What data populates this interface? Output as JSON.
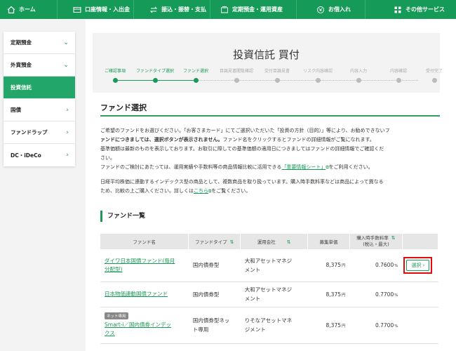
{
  "topnav": {
    "items": [
      {
        "label": "ホーム",
        "icon": "home-icon"
      },
      {
        "label": "口座情報・入出金",
        "icon": "bank-card-icon"
      },
      {
        "label": "振込・振替・支払",
        "icon": "transfer-icon"
      },
      {
        "label": "定期預金・運用資産",
        "icon": "wallet-icon"
      },
      {
        "label": "お借入れ",
        "icon": "loan-icon"
      },
      {
        "label": "その他サービス",
        "icon": "grid-icon"
      }
    ]
  },
  "sidebar": {
    "items": [
      {
        "label": "定期預金",
        "chevron": "⌄",
        "active": false
      },
      {
        "label": "外貨預金",
        "chevron": "⌄",
        "active": false
      },
      {
        "label": "投資信託",
        "chevron": "",
        "active": true
      },
      {
        "label": "国債",
        "chevron": "›",
        "active": false
      },
      {
        "label": "ファンドラップ",
        "chevron": "›",
        "active": false
      },
      {
        "label": "DC・iDeCo",
        "chevron": "›",
        "active": false
      }
    ]
  },
  "page": {
    "title": "投資信託 買付",
    "steps": [
      {
        "label": "ご確認事項",
        "state": "done"
      },
      {
        "label": "ファンドタイプ選択",
        "state": "done"
      },
      {
        "label": "ファンド選択",
        "state": "current"
      },
      {
        "label": "目論見書閲覧確認",
        "state": "todo"
      },
      {
        "label": "交付目論見書",
        "state": "todo"
      },
      {
        "label": "リスク内容確認",
        "state": "todo"
      },
      {
        "label": "内容入力",
        "state": "todo"
      },
      {
        "label": "内容確認",
        "state": "todo"
      },
      {
        "label": "受付完了",
        "state": "todo"
      }
    ],
    "section_title": "ファンド選択",
    "desc1": {
      "line1": "ご希望のファンドをお選びください。「お客さまカード」にてご選択いただいた「投資の方針（目的）」等により、お勧めできないフ",
      "line2": "ァンドにつきましては、選択ボタンが表示されません。",
      "line2b": "ファンド名をクリックするとファンドの詳細情報がご覧になれます。",
      "line3": "基準価額は最新のものを表示しております。お取引に際しての基準価額の適用日につきましてはファンドの詳細情報でご確認くだ",
      "line4": "さい。",
      "line5a": "ファンドのご検討にあたっては、運用実績や手数料等の商品情報比較に活用できる",
      "line5link": "「重要情報シート」",
      "line5b": "をご利用ください。"
    },
    "desc2": {
      "line1": "日経平均株価に連動するインデックス型の商品として、複数商品を取り扱っています。購入時手数料率などは商品によって異なる",
      "line2a": "ため、比較の上ご購入ください。詳しくは",
      "line2link": "こちら",
      "line2b": "をご覧ください。"
    },
    "list_heading": "ファンド一覧"
  },
  "table": {
    "headers": [
      "ファンド名",
      "ファンドタイプ",
      "運用会社",
      "募集単価",
      "購入時手数料率",
      "(税込・最大)"
    ],
    "rows": [
      {
        "name": "ダイワ日本国債ファンド(毎月分配型)",
        "name_l1": "ダイワ日本国債ファンド(毎月",
        "name_l2": "分配型)",
        "badge": "",
        "type_l1": "国内債券型",
        "type_l2": "",
        "company_l1": "大和アセットマネジ",
        "company_l2": "メント",
        "price": "8,375",
        "unit": "円",
        "fee": "0.7600",
        "pct": "%",
        "button": "選択 ›"
      },
      {
        "name": "日本物価連動国債ファンド",
        "name_l1": "日本物価連動国債ファンド",
        "name_l2": "",
        "badge": "",
        "type_l1": "国内債券型",
        "type_l2": "",
        "company_l1": "大和アセットマネジ",
        "company_l2": "メント",
        "price": "8,375",
        "unit": "円",
        "fee": "0.7700",
        "pct": "%",
        "button": ""
      },
      {
        "name": "Smart-i／国内債券インデックス",
        "name_l1": "Smart-i／国内債券インデッ",
        "name_l2": "クス",
        "badge": "ネット専用",
        "type_l1": "国内債券型ネッ",
        "type_l2": "ト専用",
        "company_l1": "りそなアセットマネ",
        "company_l2": "ジメント",
        "price": "8,375",
        "unit": "円",
        "fee": "0.7700",
        "pct": "%",
        "button": ""
      }
    ]
  },
  "colors": {
    "brand": "#169a57",
    "highlight": "#e10b0b"
  }
}
